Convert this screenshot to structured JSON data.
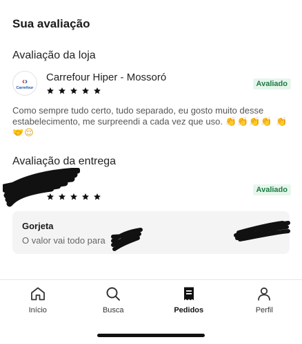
{
  "page": {
    "title": "Sua avaliação"
  },
  "store_review": {
    "section_title": "Avaliação da loja",
    "store_name": "Carrefour Hiper - Mossoró",
    "logo_text": "Carrefour",
    "rating": 5,
    "status": "Avaliado",
    "comment": "Como sempre tudo certo, tudo separado, eu gosto muito desse estabelecimento, me surpreendi a cada vez que uso."
  },
  "delivery_review": {
    "section_title": "Avaliação da entrega",
    "rating": 5,
    "status": "Avaliado"
  },
  "tip": {
    "title": "Gorjeta",
    "text": "O valor vai todo para"
  },
  "tabbar": {
    "items": [
      {
        "label": "Início",
        "icon": "home-icon"
      },
      {
        "label": "Busca",
        "icon": "search-icon"
      },
      {
        "label": "Pedidos",
        "icon": "receipt-icon",
        "active": true
      },
      {
        "label": "Perfil",
        "icon": "profile-icon"
      }
    ]
  },
  "colors": {
    "accent_green": "#1b7a43",
    "badge_bg": "#e7f6ec",
    "star": "#111111"
  }
}
